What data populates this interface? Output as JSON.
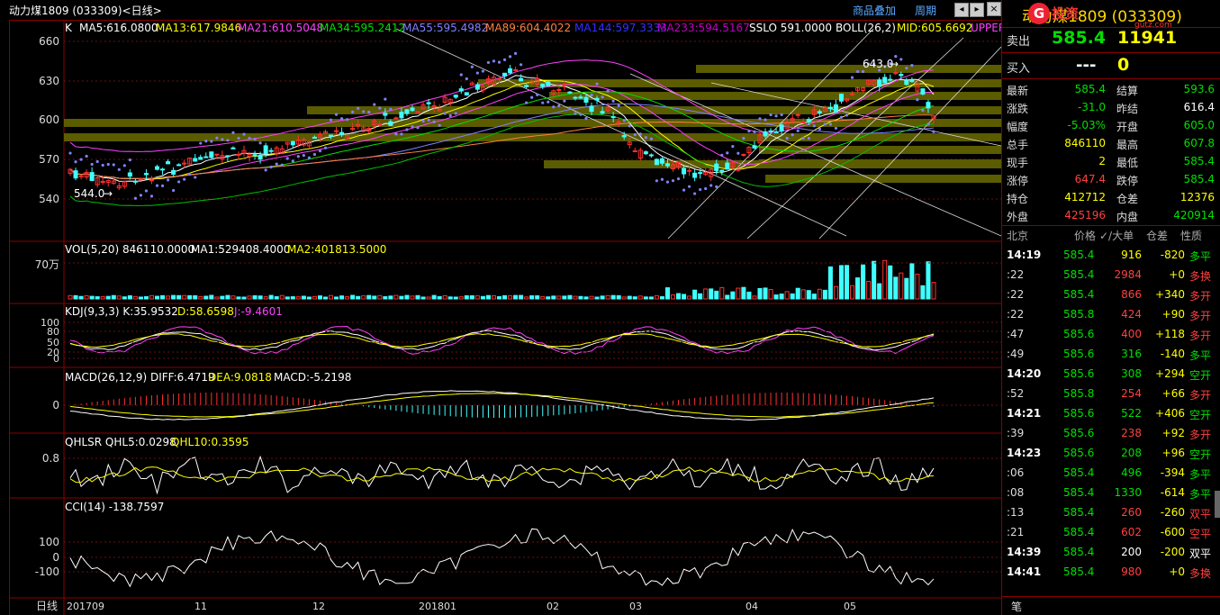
{
  "header": {
    "title": "动力煤1809 (033309)<日线>",
    "overlay_label": "商品叠加",
    "period_label": "周期",
    "close_glyph": "×"
  },
  "main_legend": {
    "k": "K",
    "ma5": "MA5:616.0800",
    "ma13": "MA13:617.9846",
    "ma21": "MA21:610.5048",
    "ma34": "MA34:595.2412",
    "ma55": "MA55:595.4982",
    "ma89": "MA89:604.4022",
    "ma144": "MA144:597.3333",
    "ma233": "MA233:594.5167",
    "sslo": "SSLO 591.0000",
    "boll": "BOLL(26,2)",
    "mid": "MID:605.6692",
    "upper": "UPPER"
  },
  "main_axis": {
    "ticks": [
      "660",
      "630",
      "600",
      "570",
      "540"
    ]
  },
  "annotations": {
    "high": "643.0",
    "low": "544.0"
  },
  "vol": {
    "legend": "VOL(5,20) 846110.0000",
    "ma1": "MA1:529408.4000",
    "ma2": "MA2:401813.5000",
    "tick": "70万"
  },
  "kdj": {
    "legend": "KDJ(9,3,3) K:35.9532",
    "d": "D:58.6598",
    "j": "J:-9.4601",
    "ticks": [
      "100",
      "80",
      "50",
      "20",
      "0"
    ]
  },
  "macd": {
    "legend": "MACD(26,12,9) DIFF:6.4719",
    "dea": "DEA:9.0818",
    "macd": "MACD:-5.2198",
    "tick": "0"
  },
  "qhlsr": {
    "legend": "QHLSR QHL5:0.0298",
    "qhl10": "QHL10:0.3595",
    "tick": "0.8"
  },
  "cci": {
    "legend": "CCI(14) -138.7597",
    "ticks": [
      "100",
      "0",
      "-100"
    ]
  },
  "xaxis": {
    "label": "日线",
    "ticks": [
      "201709",
      "11",
      "12",
      "201801",
      "02",
      "03",
      "04",
      "05"
    ]
  },
  "side": {
    "title": "动力煤1809 (033309)",
    "logo_text": "投资",
    "logo_sub": "gutz.com",
    "sell_label": "卖出",
    "sell_price": "585.4",
    "sell_vol": "11941",
    "buy_label": "买入",
    "buy_price": "---",
    "buy_vol": "0",
    "stats": [
      {
        "l1": "最新",
        "v1": "585.4",
        "c1": "green",
        "l2": "结算",
        "v2": "593.6",
        "c2": "green"
      },
      {
        "l1": "涨跌",
        "v1": "-31.0",
        "c1": "green",
        "l2": "昨结",
        "v2": "616.4",
        "c2": "white"
      },
      {
        "l1": "幅度",
        "v1": "-5.03%",
        "c1": "green",
        "l2": "开盘",
        "v2": "605.0",
        "c2": "green"
      },
      {
        "l1": "总手",
        "v1": "846110",
        "c1": "yellow",
        "l2": "最高",
        "v2": "607.8",
        "c2": "green"
      },
      {
        "l1": "现手",
        "v1": "2",
        "c1": "yellow",
        "l2": "最低",
        "v2": "585.4",
        "c2": "green"
      },
      {
        "l1": "涨停",
        "v1": "647.4",
        "c1": "red",
        "l2": "跌停",
        "v2": "585.4",
        "c2": "green"
      },
      {
        "l1": "持仓",
        "v1": "412712",
        "c1": "yellow",
        "l2": "仓差",
        "v2": "12376",
        "c2": "yellow"
      },
      {
        "l1": "外盘",
        "v1": "425196",
        "c1": "red",
        "l2": "内盘",
        "v2": "420914",
        "c2": "green"
      }
    ],
    "tick_header": {
      "time": "北京",
      "price": "价格",
      "vol": "✓/大单",
      "oi": "仓差",
      "nature": "性质"
    },
    "ticks": [
      {
        "t": "14:19",
        "p": "585.4",
        "v": "916",
        "vc": "yellow",
        "o": "-820",
        "oc": "yellow",
        "n": "多平",
        "nc": "green"
      },
      {
        "t": ":22",
        "p": "585.4",
        "v": "2984",
        "vc": "red",
        "o": "+0",
        "oc": "yellow",
        "n": "多换",
        "nc": "red"
      },
      {
        "t": ":22",
        "p": "585.4",
        "v": "866",
        "vc": "red",
        "o": "+340",
        "oc": "yellow",
        "n": "多开",
        "nc": "red"
      },
      {
        "t": ":22",
        "p": "585.8",
        "v": "424",
        "vc": "red",
        "o": "+90",
        "oc": "yellow",
        "n": "多开",
        "nc": "red"
      },
      {
        "t": ":47",
        "p": "585.6",
        "v": "400",
        "vc": "red",
        "o": "+118",
        "oc": "yellow",
        "n": "多开",
        "nc": "red"
      },
      {
        "t": ":49",
        "p": "585.6",
        "v": "316",
        "vc": "green",
        "o": "-140",
        "oc": "yellow",
        "n": "多平",
        "nc": "green"
      },
      {
        "t": "14:20",
        "p": "585.6",
        "v": "308",
        "vc": "green",
        "o": "+294",
        "oc": "yellow",
        "n": "空开",
        "nc": "green"
      },
      {
        "t": ":52",
        "p": "585.8",
        "v": "254",
        "vc": "red",
        "o": "+66",
        "oc": "yellow",
        "n": "多开",
        "nc": "red"
      },
      {
        "t": "14:21",
        "p": "585.6",
        "v": "522",
        "vc": "green",
        "o": "+406",
        "oc": "yellow",
        "n": "空开",
        "nc": "green"
      },
      {
        "t": ":39",
        "p": "585.6",
        "v": "238",
        "vc": "red",
        "o": "+92",
        "oc": "yellow",
        "n": "多开",
        "nc": "red"
      },
      {
        "t": "14:23",
        "p": "585.6",
        "v": "208",
        "vc": "green",
        "o": "+96",
        "oc": "yellow",
        "n": "空开",
        "nc": "green"
      },
      {
        "t": ":06",
        "p": "585.4",
        "v": "496",
        "vc": "green",
        "o": "-394",
        "oc": "yellow",
        "n": "多平",
        "nc": "green"
      },
      {
        "t": ":08",
        "p": "585.4",
        "v": "1330",
        "vc": "green",
        "o": "-614",
        "oc": "yellow",
        "n": "多平",
        "nc": "green"
      },
      {
        "t": ":13",
        "p": "585.4",
        "v": "260",
        "vc": "red",
        "o": "-260",
        "oc": "yellow",
        "n": "双平",
        "nc": "red"
      },
      {
        "t": ":21",
        "p": "585.4",
        "v": "602",
        "vc": "red",
        "o": "-600",
        "oc": "yellow",
        "n": "空平",
        "nc": "red"
      },
      {
        "t": "14:39",
        "p": "585.4",
        "v": "200",
        "vc": "white",
        "o": "-200",
        "oc": "yellow",
        "n": "双平",
        "nc": "white"
      },
      {
        "t": "14:41",
        "p": "585.4",
        "v": "980",
        "vc": "red",
        "o": "+0",
        "oc": "yellow",
        "n": "多换",
        "nc": "red"
      }
    ],
    "footer": "笔"
  }
}
